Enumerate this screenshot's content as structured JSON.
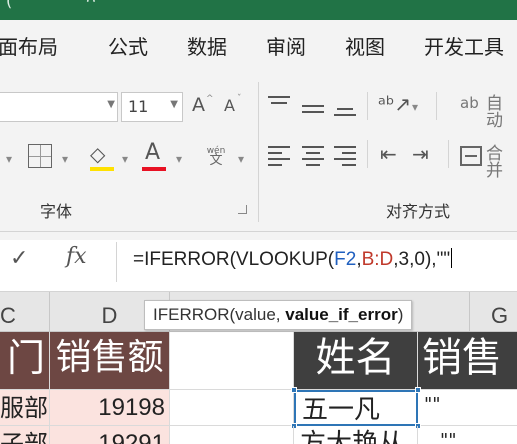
{
  "title_bar": {
    "glyphs": [
      "(",
      "ᴖ"
    ]
  },
  "ribbon_tabs": [
    "页面布局",
    "公式",
    "数据",
    "审阅",
    "视图",
    "开发工具"
  ],
  "font_group": {
    "font_size": "11",
    "grow_font": "A",
    "shrink_font": "A",
    "font_color_glyph": "A",
    "phonetic_top": "wén",
    "phonetic_bottom": "文",
    "label": "字体"
  },
  "align_group": {
    "wrap_text": "自动",
    "merge": "合并",
    "label": "对齐方式"
  },
  "formula_bar": {
    "cancel": "✕",
    "enter": "✓",
    "fx": "fx",
    "formula_prefix": "=IFERROR(VLOOKUP(",
    "ref1": "F2",
    "comma1": ",",
    "ref2": "B:D",
    "formula_suffix": ",3,0),\"\""
  },
  "tooltip": {
    "text": "IFERROR(value, ",
    "bold": "value_if_error",
    "close": ")"
  },
  "columns": [
    "C",
    "D",
    "G"
  ],
  "cells": {
    "c1": "门",
    "d1": "销售额",
    "f1": "姓名",
    "g1": "销售",
    "c2": "服部",
    "d2": "19198",
    "f2": "五一凡",
    "g2": "\"\"",
    "c3": "子部",
    "d3": "19291",
    "f3": "方大艳从",
    "g3": "\"\""
  },
  "colors": {
    "title_green": "#217346",
    "header_dark": "#3f3f3f",
    "header_brown": "#6d4743",
    "pink_fill": "#fbe3df",
    "ref_blue": "#1f5fbf",
    "ref_red": "#c0392b"
  }
}
